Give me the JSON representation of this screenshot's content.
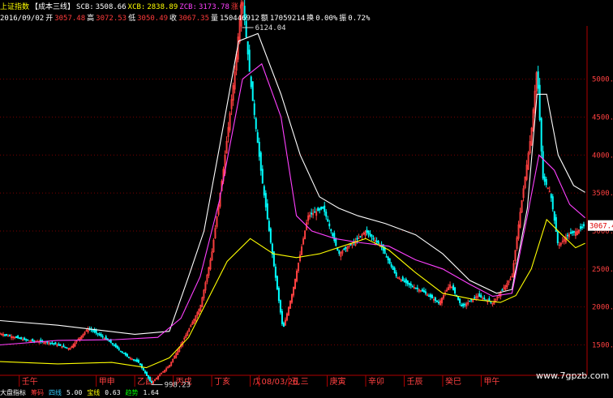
{
  "header": {
    "index_name": "上证指数",
    "indicator": "【成本三线】",
    "scb_label": "SCB:",
    "scb_value": "3508.66",
    "xcb_label": "XCB:",
    "xcb_value": "2838.89",
    "zcb_label": "ZCB:",
    "zcb_value": "3173.78",
    "extra": "涨(",
    "date": "2016/09/02",
    "open_label": "开",
    "open_value": "3057.48",
    "high_label": "高",
    "high_value": "3072.53",
    "low_label": "低",
    "low_value": "3050.49",
    "close_label": "收",
    "close_value": "3067.35",
    "vol_label": "量",
    "vol_value": "150446912",
    "amt_label": "额",
    "amt_value": "17059214",
    "turn_label": "换",
    "turn_value": "0.00%",
    "amp_label": "振",
    "amp_value": "0.72%"
  },
  "colors": {
    "background": "#000000",
    "axis": "#b00000",
    "grid": "#7a0000",
    "up_candle": "#ff4040",
    "down_candle": "#00ffff",
    "scb_line": "#ffffff",
    "zcb_line": "#ff40ff",
    "xcb_line": "#ffff00"
  },
  "watermark": "www.7gpzb.com",
  "bottom_legend": [
    "大盘指标",
    "筹码",
    "四线",
    "5.00",
    "宝线",
    "0.63",
    "趋势",
    "1.64"
  ],
  "chart_data": {
    "type": "candlestick",
    "y_axis": {
      "ticks": [
        1500,
        2000,
        2500,
        3000,
        3500,
        4000,
        4500,
        5000
      ],
      "ylim": [
        1100,
        5700
      ],
      "scale": "linear",
      "position": "right"
    },
    "current_price_label": "3067.4",
    "grid": true,
    "annotations": [
      {
        "text": "6124.04",
        "x": 2007.79,
        "y": 6124.04
      },
      {
        "text": "998.23",
        "x": 2005.43,
        "y": 998.23
      }
    ],
    "x_axis": {
      "ticks": [
        {
          "label": "壬午",
          "x": 2002
        },
        {
          "label": "甲申",
          "x": 2004
        },
        {
          "label": "乙酉",
          "x": 2005
        },
        {
          "label": "丙戌",
          "x": 2006
        },
        {
          "label": "丁亥",
          "x": 2007
        },
        {
          "label": "戊",
          "x": 2008
        },
        {
          "label": "08/03/26,三",
          "x": 2008.23
        },
        {
          "label": "丑",
          "x": 2009
        },
        {
          "label": "庚寅",
          "x": 2010
        },
        {
          "label": "辛卯",
          "x": 2011
        },
        {
          "label": "壬辰",
          "x": 2012
        },
        {
          "label": "癸巳",
          "x": 2013
        },
        {
          "label": "甲午",
          "x": 2014
        }
      ],
      "xlim": [
        2001.5,
        2016.75
      ]
    },
    "series": [
      {
        "name": "SCB",
        "values": [
          [
            2001.5,
            1820
          ],
          [
            2003,
            1760
          ],
          [
            2005,
            1640
          ],
          [
            2005.9,
            1680
          ],
          [
            2006.4,
            2400
          ],
          [
            2006.8,
            3000
          ],
          [
            2007.2,
            4100
          ],
          [
            2007.7,
            5500
          ],
          [
            2008.2,
            5600
          ],
          [
            2008.8,
            4800
          ],
          [
            2009.3,
            4000
          ],
          [
            2009.8,
            3450
          ],
          [
            2010.3,
            3300
          ],
          [
            2010.8,
            3200
          ],
          [
            2011.5,
            3100
          ],
          [
            2012.3,
            2950
          ],
          [
            2013.0,
            2700
          ],
          [
            2013.7,
            2350
          ],
          [
            2014.4,
            2180
          ],
          [
            2014.8,
            2230
          ],
          [
            2015.2,
            3300
          ],
          [
            2015.45,
            4800
          ],
          [
            2015.7,
            4800
          ],
          [
            2016.0,
            4000
          ],
          [
            2016.4,
            3600
          ],
          [
            2016.7,
            3509
          ]
        ]
      },
      {
        "name": "ZCB",
        "values": [
          [
            2001.5,
            1500
          ],
          [
            2003,
            1560
          ],
          [
            2004.5,
            1570
          ],
          [
            2005.6,
            1600
          ],
          [
            2006.2,
            1850
          ],
          [
            2006.7,
            2400
          ],
          [
            2007.2,
            3400
          ],
          [
            2007.8,
            5000
          ],
          [
            2008.3,
            5200
          ],
          [
            2008.8,
            4500
          ],
          [
            2009.2,
            3200
          ],
          [
            2009.6,
            3000
          ],
          [
            2010.2,
            2900
          ],
          [
            2010.8,
            2850
          ],
          [
            2011.6,
            2800
          ],
          [
            2012.3,
            2620
          ],
          [
            2013.0,
            2500
          ],
          [
            2013.7,
            2300
          ],
          [
            2014.3,
            2140
          ],
          [
            2014.8,
            2180
          ],
          [
            2015.2,
            3200
          ],
          [
            2015.5,
            4000
          ],
          [
            2015.9,
            3800
          ],
          [
            2016.3,
            3350
          ],
          [
            2016.7,
            3174
          ]
        ]
      },
      {
        "name": "XCB",
        "values": [
          [
            2001.5,
            1280
          ],
          [
            2003,
            1250
          ],
          [
            2004.4,
            1270
          ],
          [
            2005.3,
            1200
          ],
          [
            2005.9,
            1330
          ],
          [
            2006.4,
            1600
          ],
          [
            2006.9,
            2100
          ],
          [
            2007.4,
            2600
          ],
          [
            2008.0,
            2900
          ],
          [
            2008.6,
            2700
          ],
          [
            2009.2,
            2650
          ],
          [
            2009.8,
            2700
          ],
          [
            2010.4,
            2800
          ],
          [
            2011.0,
            2900
          ],
          [
            2011.6,
            2750
          ],
          [
            2012.3,
            2450
          ],
          [
            2013.0,
            2180
          ],
          [
            2013.8,
            2100
          ],
          [
            2014.5,
            2060
          ],
          [
            2014.9,
            2150
          ],
          [
            2015.3,
            2500
          ],
          [
            2015.7,
            3150
          ],
          [
            2016.1,
            2950
          ],
          [
            2016.45,
            2780
          ],
          [
            2016.7,
            2839
          ]
        ]
      },
      {
        "name": "close",
        "values": [
          [
            2001.5,
            1650
          ],
          [
            2002.2,
            1560
          ],
          [
            2002.8,
            1530
          ],
          [
            2003.3,
            1450
          ],
          [
            2003.8,
            1720
          ],
          [
            2004.3,
            1560
          ],
          [
            2004.8,
            1350
          ],
          [
            2005.1,
            1270
          ],
          [
            2005.43,
            998
          ],
          [
            2005.9,
            1230
          ],
          [
            2006.3,
            1600
          ],
          [
            2006.7,
            2000
          ],
          [
            2007.0,
            2700
          ],
          [
            2007.3,
            3800
          ],
          [
            2007.6,
            5100
          ],
          [
            2007.79,
            6124
          ],
          [
            2008.0,
            5000
          ],
          [
            2008.3,
            3700
          ],
          [
            2008.6,
            2600
          ],
          [
            2008.85,
            1700
          ],
          [
            2009.1,
            2200
          ],
          [
            2009.5,
            3200
          ],
          [
            2009.9,
            3300
          ],
          [
            2010.3,
            2700
          ],
          [
            2010.7,
            2850
          ],
          [
            2011.0,
            3000
          ],
          [
            2011.4,
            2800
          ],
          [
            2011.8,
            2400
          ],
          [
            2012.1,
            2300
          ],
          [
            2012.5,
            2200
          ],
          [
            2012.9,
            2050
          ],
          [
            2013.2,
            2300
          ],
          [
            2013.5,
            2000
          ],
          [
            2013.9,
            2150
          ],
          [
            2014.3,
            2050
          ],
          [
            2014.8,
            2400
          ],
          [
            2015.0,
            3200
          ],
          [
            2015.3,
            4300
          ],
          [
            2015.45,
            5160
          ],
          [
            2015.6,
            3700
          ],
          [
            2015.8,
            3500
          ],
          [
            2016.0,
            2800
          ],
          [
            2016.25,
            2950
          ],
          [
            2016.5,
            3000
          ],
          [
            2016.67,
            3067
          ]
        ]
      }
    ]
  }
}
